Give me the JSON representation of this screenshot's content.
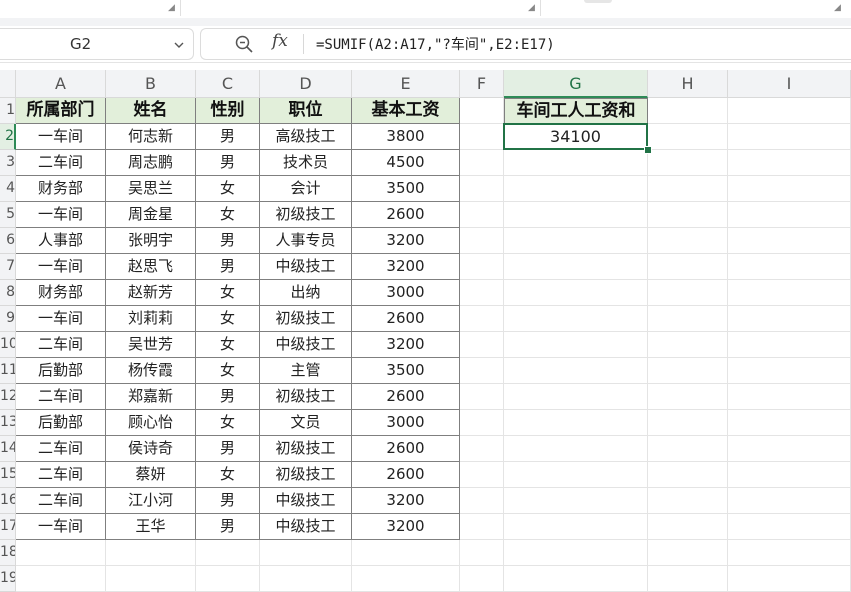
{
  "name_box": "G2",
  "formula": "=SUMIF(A2:A17,\"?车间\",E2:E17)",
  "icons": {
    "zoom": "zoom-search-icon",
    "function": "fx-icon",
    "dropdown": "chevron-down-icon"
  },
  "fx_label": "fx",
  "colors": {
    "accent": "#217346",
    "header_fill": "#e2efda",
    "selected_header": "#e3efe3"
  },
  "columns": [
    "A",
    "B",
    "C",
    "D",
    "E",
    "F",
    "G",
    "H",
    "I"
  ],
  "selected_column": "G",
  "selected_row": 2,
  "row_numbers": [
    "1",
    "2",
    "3",
    "4",
    "5",
    "6",
    "7",
    "8",
    "9",
    "10",
    "11",
    "12",
    "13",
    "14",
    "15",
    "16",
    "17",
    "18",
    "19"
  ],
  "table": {
    "headers": [
      "所属部门",
      "姓名",
      "性别",
      "职位",
      "基本工资"
    ],
    "rows": [
      [
        "一车间",
        "何志新",
        "男",
        "高级技工",
        "3800"
      ],
      [
        "二车间",
        "周志鹏",
        "男",
        "技术员",
        "4500"
      ],
      [
        "财务部",
        "吴思兰",
        "女",
        "会计",
        "3500"
      ],
      [
        "一车间",
        "周金星",
        "女",
        "初级技工",
        "2600"
      ],
      [
        "人事部",
        "张明宇",
        "男",
        "人事专员",
        "3200"
      ],
      [
        "一车间",
        "赵思飞",
        "男",
        "中级技工",
        "3200"
      ],
      [
        "财务部",
        "赵新芳",
        "女",
        "出纳",
        "3000"
      ],
      [
        "一车间",
        "刘莉莉",
        "女",
        "初级技工",
        "2600"
      ],
      [
        "二车间",
        "吴世芳",
        "女",
        "中级技工",
        "3200"
      ],
      [
        "后勤部",
        "杨传霞",
        "女",
        "主管",
        "3500"
      ],
      [
        "二车间",
        "郑嘉新",
        "男",
        "初级技工",
        "2600"
      ],
      [
        "后勤部",
        "顾心怡",
        "女",
        "文员",
        "3000"
      ],
      [
        "二车间",
        "侯诗奇",
        "男",
        "初级技工",
        "2600"
      ],
      [
        "二车间",
        "蔡妍",
        "女",
        "初级技工",
        "2600"
      ],
      [
        "二车间",
        "江小河",
        "男",
        "中级技工",
        "3200"
      ],
      [
        "一车间",
        "王华",
        "男",
        "中级技工",
        "3200"
      ]
    ]
  },
  "result": {
    "header": "车间工人工资和",
    "value": "34100"
  }
}
